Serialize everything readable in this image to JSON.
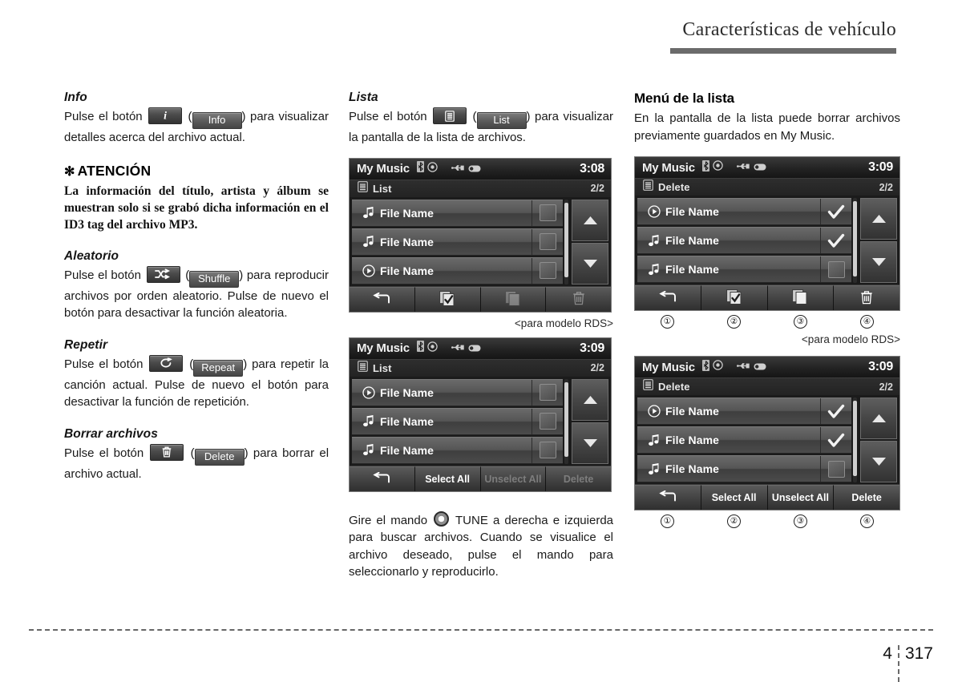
{
  "header": {
    "title": "Características de vehículo"
  },
  "footer": {
    "chapter": "4",
    "page": "317"
  },
  "left_column": {
    "info": {
      "heading": "Info",
      "text_before": "Pulse el botón",
      "icon_name": "info-icon",
      "paren_open": "(",
      "button_label": "Info",
      "paren_close": ")",
      "text_after": "para visualizar detalles acerca del archivo actual."
    },
    "notice": {
      "star": "✻",
      "title": "ATENCIÓN",
      "body": "La información del título, artista y álbum se muestran solo si se grabó dicha información en el ID3 tag del archivo MP3."
    },
    "shuffle": {
      "heading": "Aleatorio",
      "text_before": "Pulse el botón",
      "icon_name": "shuffle-icon",
      "paren_open": "(",
      "button_label": "Shuffle",
      "paren_close": ")",
      "text_after": "para reproducir archivos por orden aleatorio. Pulse de nuevo el botón para desactivar la función aleatoria."
    },
    "repeat": {
      "heading": "Repetir",
      "text_before": "Pulse el botón",
      "icon_name": "repeat-icon",
      "paren_open": "(",
      "button_label": "Repeat",
      "paren_close": ")",
      "text_after": "para repetir la canción actual. Pulse de nuevo el botón para desactivar la función de repetición."
    },
    "delete": {
      "heading": "Borrar archivos",
      "text_before": "Pulse el botón",
      "icon_name": "trash-icon",
      "paren_open": "(",
      "button_label": "Delete",
      "paren_close": ")",
      "text_after": "para borrar el archivo actual."
    }
  },
  "middle_column": {
    "list": {
      "heading": "Lista",
      "text_before": "Pulse el botón",
      "icon_name": "list-icon",
      "paren_open": "(",
      "button_label": "List",
      "paren_close": ")",
      "text_after": "para visualizar la pantalla de la lista de archivos."
    },
    "screen1": {
      "title": "My Music",
      "status_icons": [
        "bluetooth-icon",
        "disc-icon",
        "usb-icon",
        "ipod-icon"
      ],
      "clock": "3:08",
      "subbar_icon": "list-icon",
      "subbar_label": "List",
      "pages": "2/2",
      "rows": [
        {
          "icon": "music-note-icon",
          "label": "File Name",
          "checked": false
        },
        {
          "icon": "music-note-icon",
          "label": "File Name",
          "checked": false
        },
        {
          "icon": "play-circle-icon",
          "label": "File Name",
          "checked": false
        }
      ],
      "scroll_up": "scroll-up-icon",
      "scroll_down": "scroll-down-icon",
      "toolbar": [
        {
          "icon": "back-arrow-icon",
          "label": "",
          "dim": false
        },
        {
          "icon": "select-all-icon",
          "label": "",
          "dim": false
        },
        {
          "icon": "unselect-all-icon",
          "label": "",
          "dim": true
        },
        {
          "icon": "trash-icon",
          "label": "",
          "dim": true
        }
      ]
    },
    "caption1": "<para modelo RDS>",
    "screen2": {
      "title": "My Music",
      "status_icons": [
        "bluetooth-icon",
        "disc-icon",
        "usb-icon",
        "ipod-icon"
      ],
      "clock": "3:09",
      "subbar_icon": "list-icon",
      "subbar_label": "List",
      "pages": "2/2",
      "rows": [
        {
          "icon": "play-circle-icon",
          "label": "File Name",
          "checked": false
        },
        {
          "icon": "music-note-icon",
          "label": "File Name",
          "checked": false
        },
        {
          "icon": "music-note-icon",
          "label": "File Name",
          "checked": false
        }
      ],
      "scroll_up": "scroll-up-icon",
      "scroll_down": "scroll-down-icon",
      "toolbar": [
        {
          "icon": "back-arrow-icon",
          "label": "",
          "dim": false
        },
        {
          "icon": "",
          "label": "Select All",
          "dim": false
        },
        {
          "icon": "",
          "label": "Unselect All",
          "dim": true
        },
        {
          "icon": "",
          "label": "Delete",
          "dim": true
        }
      ]
    },
    "tune_text_1": "Gire el mando",
    "tune_knob": "tune-knob-icon",
    "tune_text_2": "TUNE a derecha e izquierda para buscar archivos. Cuando se visualice el archivo deseado, pulse el mando para seleccionarlo y reproducirlo."
  },
  "right_column": {
    "menu": {
      "heading": "Menú de la lista",
      "text": "En la pantalla de la lista puede borrar archivos previamente guardados en My Music."
    },
    "screen3": {
      "title": "My Music",
      "status_icons": [
        "bluetooth-icon",
        "disc-icon",
        "usb-icon",
        "ipod-icon"
      ],
      "clock": "3:09",
      "subbar_icon": "list-icon",
      "subbar_label": "Delete",
      "pages": "2/2",
      "rows": [
        {
          "icon": "play-circle-icon",
          "label": "File Name",
          "checked": true
        },
        {
          "icon": "music-note-icon",
          "label": "File Name",
          "checked": true
        },
        {
          "icon": "music-note-icon",
          "label": "File Name",
          "checked": false
        }
      ],
      "scroll_up": "scroll-up-icon",
      "scroll_down": "scroll-down-icon",
      "toolbar": [
        {
          "icon": "back-arrow-icon",
          "label": "",
          "dim": false
        },
        {
          "icon": "select-all-icon",
          "label": "",
          "dim": false
        },
        {
          "icon": "unselect-all-icon",
          "label": "",
          "dim": false
        },
        {
          "icon": "trash-icon",
          "label": "",
          "dim": false
        }
      ],
      "callouts": [
        "①",
        "②",
        "③",
        "④"
      ]
    },
    "caption3": "<para modelo RDS>",
    "screen4": {
      "title": "My Music",
      "status_icons": [
        "bluetooth-icon",
        "disc-icon",
        "usb-icon",
        "ipod-icon"
      ],
      "clock": "3:09",
      "subbar_icon": "list-icon",
      "subbar_label": "Delete",
      "pages": "2/2",
      "rows": [
        {
          "icon": "play-circle-icon",
          "label": "File Name",
          "checked": true
        },
        {
          "icon": "music-note-icon",
          "label": "File Name",
          "checked": true
        },
        {
          "icon": "music-note-icon",
          "label": "File Name",
          "checked": false
        }
      ],
      "scroll_up": "scroll-up-icon",
      "scroll_down": "scroll-down-icon",
      "toolbar": [
        {
          "icon": "back-arrow-icon",
          "label": "",
          "dim": false
        },
        {
          "icon": "",
          "label": "Select All",
          "dim": false
        },
        {
          "icon": "",
          "label": "Unselect All",
          "dim": false
        },
        {
          "icon": "",
          "label": "Delete",
          "dim": false
        }
      ],
      "callouts": [
        "①",
        "②",
        "③",
        "④"
      ]
    }
  }
}
